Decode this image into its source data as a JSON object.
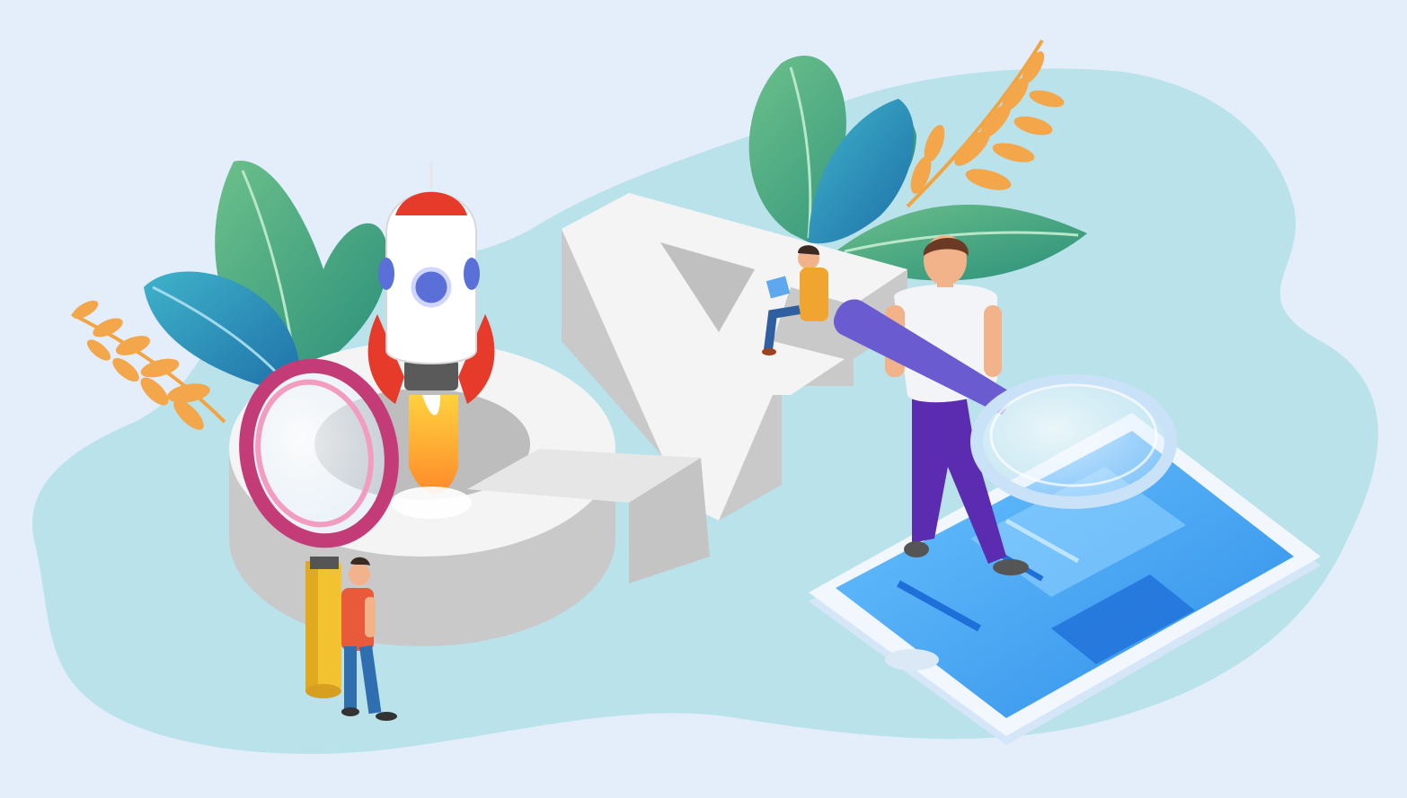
{
  "illustration": {
    "subject": "qa-testing-isometric",
    "letters": [
      "Q",
      "A"
    ],
    "elements": [
      "leaf-plant-left",
      "fern-sprig-left",
      "rocket",
      "pink-magnifier",
      "man-with-pencil",
      "leaf-plant-right",
      "fern-sprig-right",
      "person-with-laptop",
      "man-with-magnifier",
      "tablet-device"
    ]
  },
  "colors": {
    "background": "#e3eefa",
    "blob": "#b9e2ea",
    "letter_face": "#f4f4f4",
    "letter_side": "#c9c9c9",
    "leaf_green": "#4fae86",
    "leaf_teal": "#2b9fb8",
    "fern_orange": "#f2a441",
    "rocket_red": "#e63a2b",
    "magnifier_pink": "#c33c78",
    "pencil_yellow": "#f2c230",
    "shirt_red": "#e85a3a",
    "pants_blue": "#2f6fb0",
    "tablet_screen": "#4aa8f2",
    "tablet_frame": "#f1f7fd",
    "pants_purple": "#5b2bb0",
    "magnifier_purple": "#6a5bd1"
  }
}
